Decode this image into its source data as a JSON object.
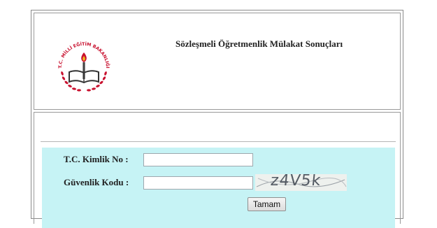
{
  "page": {
    "title": "Sözleşmeli Öğretmenlik Mülakat Sonuçları"
  },
  "logo": {
    "arc_text": "T.C. MİLLİ EĞİTİM BAKANLIĞI",
    "icon": "ministry-of-education-emblem"
  },
  "form": {
    "tc_label": "T.C. Kimlik No :",
    "tc_value": "",
    "security_label": "Güvenlik Kodu :",
    "security_value": "",
    "captcha_text": "z4V5k",
    "submit_label": "Tamam"
  },
  "colors": {
    "form_background": "#c6f3f5",
    "logo_red": "#c8102e",
    "border": "#9a9a9a"
  }
}
